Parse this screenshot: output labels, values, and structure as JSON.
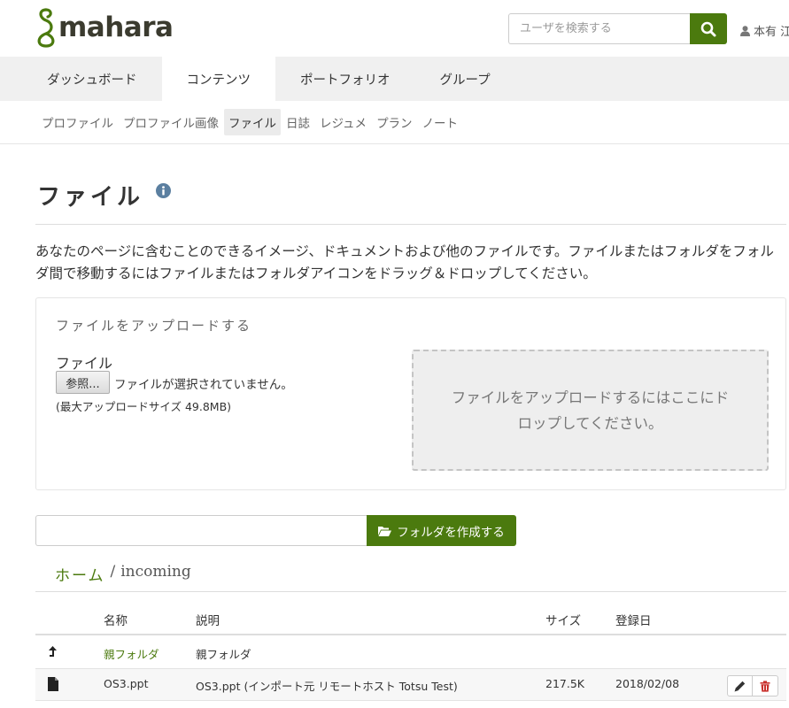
{
  "header": {
    "logo_text": "mahara",
    "search_placeholder": "ユーザを検索する",
    "user_name": "本有 江"
  },
  "main_nav": [
    {
      "label": "ダッシュボード",
      "active": false
    },
    {
      "label": "コンテンツ",
      "active": true
    },
    {
      "label": "ポートフォリオ",
      "active": false
    },
    {
      "label": "グループ",
      "active": false
    }
  ],
  "sub_nav": [
    {
      "label": "プロファイル",
      "active": false
    },
    {
      "label": "プロファイル画像",
      "active": false
    },
    {
      "label": "ファイル",
      "active": true
    },
    {
      "label": "日誌",
      "active": false
    },
    {
      "label": "レジュメ",
      "active": false
    },
    {
      "label": "プラン",
      "active": false
    },
    {
      "label": "ノート",
      "active": false
    }
  ],
  "page": {
    "title": "ファイル",
    "intro": "あなたのページに含むことのできるイメージ、ドキュメントおよび他のファイルです。ファイルまたはフォルダをフォルダ間で移動するにはファイルまたはフォルダアイコンをドラッグ＆ドロップしてください。"
  },
  "upload": {
    "heading": "ファイルをアップロードする",
    "file_label": "ファイル",
    "browse_label": "参照...",
    "no_file_text": "ファイルが選択されていません。",
    "max_size": "(最大アップロードサイズ 49.8MB)",
    "dropzone_text": "ファイルをアップロードするにはここにドロップしてください。"
  },
  "create_folder": {
    "button_label": "フォルダを作成する",
    "input_value": ""
  },
  "breadcrumb": {
    "home": "ホーム",
    "separator": "/",
    "current": "incoming"
  },
  "files_table": {
    "headers": {
      "name": "名称",
      "description": "説明",
      "size": "サイズ",
      "date": "登録日"
    },
    "parent_row": {
      "name": "親フォルダ",
      "description": "親フォルダ"
    },
    "rows": [
      {
        "name": "OS3.ppt",
        "description": "OS3.ppt (インポート元 リモートホスト Totsu Test)",
        "size": "217.5K",
        "date": "2018/02/08"
      }
    ]
  },
  "colors": {
    "brand_green": "#4b7a0e",
    "nav_bg": "#f0f0f0",
    "delete_red": "#c9302c"
  },
  "icons": {
    "search": "search-icon",
    "user": "user-icon",
    "info": "info-icon",
    "folder_open": "folder-open-icon",
    "parent": "level-up-icon",
    "file": "file-icon",
    "edit": "pencil-icon",
    "delete": "trash-icon"
  }
}
